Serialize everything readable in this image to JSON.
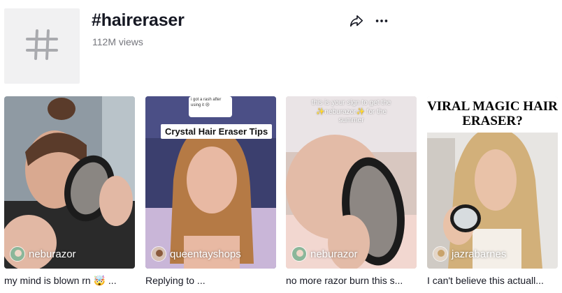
{
  "header": {
    "title": "#haireraser",
    "views": "112M views",
    "avatar_icon": "hashtag-icon",
    "share_icon": "share-icon",
    "more_icon": "more-icon"
  },
  "videos": [
    {
      "creator": "neburazor",
      "caption": "my mind is blown rn 🤯 ...",
      "overlay": ""
    },
    {
      "creator": "queentayshops",
      "caption": "Replying to ...",
      "banner": "Crystal Hair Eraser Tips",
      "bubble": "i got a rash after using it 😢"
    },
    {
      "creator": "neburazor",
      "caption": "no more razor burn this s...",
      "overlay": "this is your sign to get the ✨neburazor✨ for the summer"
    },
    {
      "creator": "jazrabarnes",
      "caption": "I can't believe this actuall...",
      "headline": "VIRAL MAGIC HAIR ERASER?"
    }
  ]
}
